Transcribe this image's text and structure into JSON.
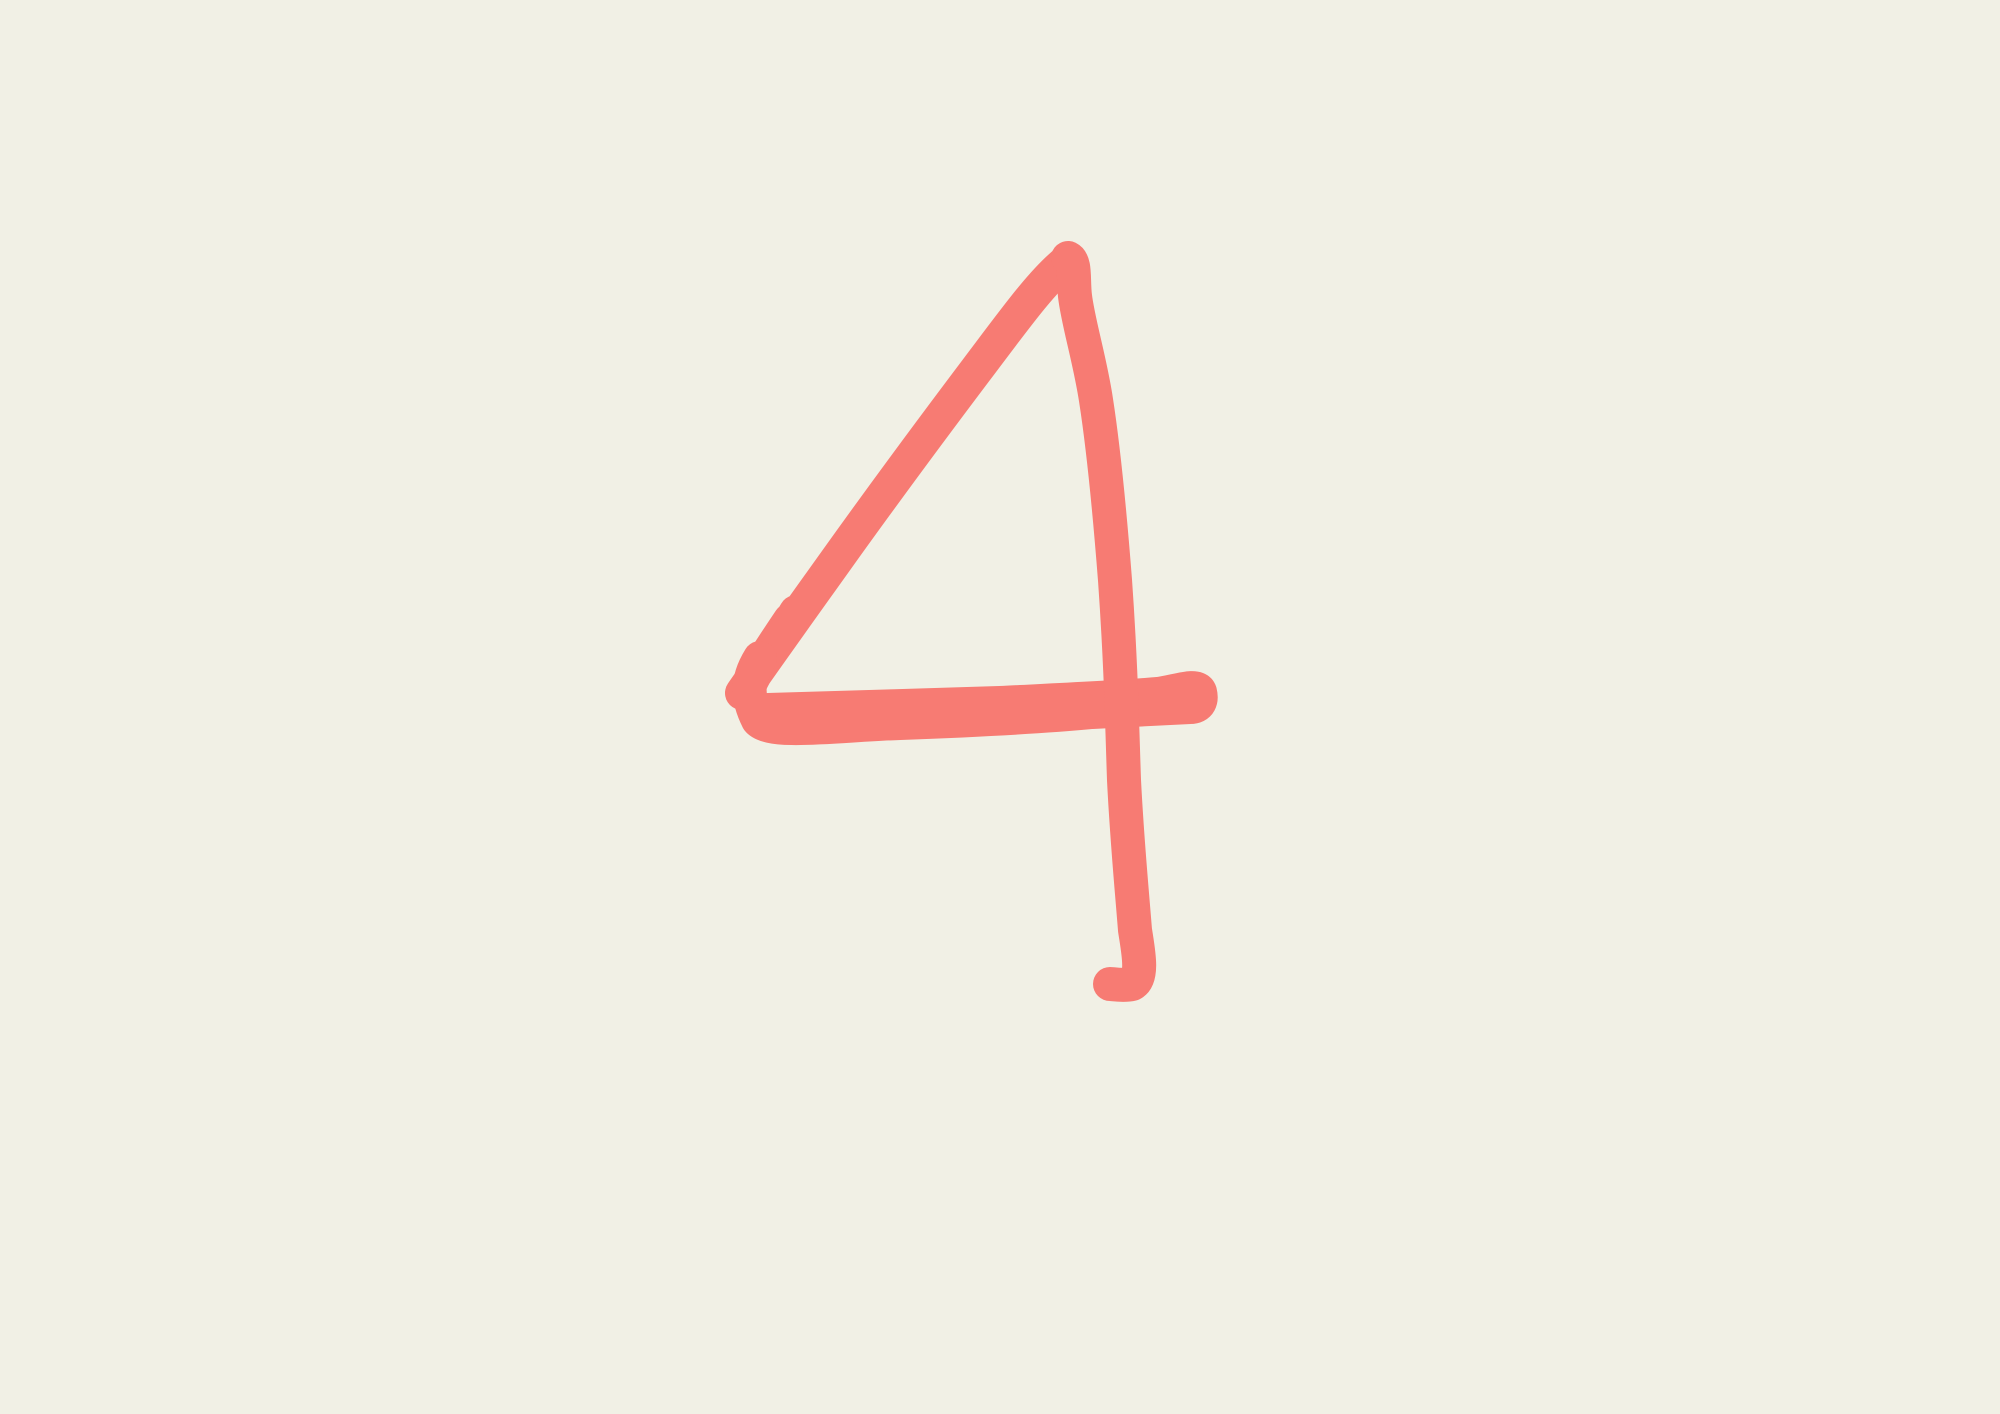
{
  "background_color": "#f1f0e5",
  "stroke_color": "#f77b73",
  "glyph": {
    "icon": "handwritten-digit-four-icon"
  }
}
